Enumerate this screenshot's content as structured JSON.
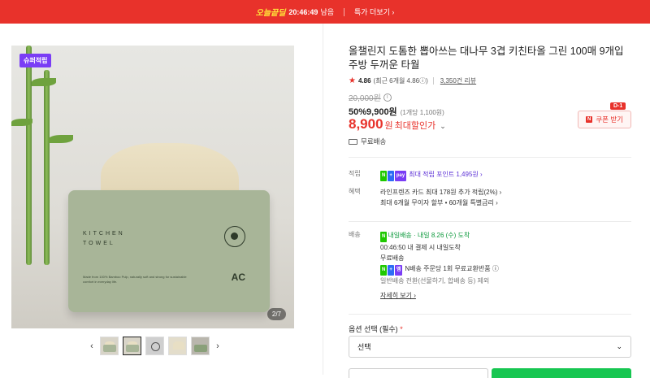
{
  "topbar": {
    "badge": "오늘끝딜",
    "timer": "20:46:49",
    "remain": "남음",
    "deal_link": "특가 더보기 ›"
  },
  "gallery": {
    "super_badge": "슈퍼적립",
    "counter": "2/7",
    "box_text_line1": "KITCHEN",
    "box_text_line2": "TOWEL",
    "box_fine": "Made from 100% Bamboo Pulp, naturally soft and strong for sustainable comfort in everyday life.",
    "box_mark": "AC",
    "prev": "‹",
    "next": "›"
  },
  "product": {
    "title": "올챌린지 도톰한 뽑아쓰는 대나무 3겹 키친타올 그린 100매 9개입 주방 두꺼운 타월",
    "rating": "4.86",
    "rating_recent": "(최근 6개월 4.86ⓘ)",
    "reviews": "3,350건 리뷰",
    "orig_price": "20,000원",
    "discount": "50%",
    "sale_price": "9,900원",
    "unit_price": "(1개당 1,100원)",
    "max_price": "8,900",
    "max_price_unit": "원",
    "max_label": "최대할인가",
    "coupon_label": "쿠폰 받기",
    "coupon_dday": "D-1",
    "shipping": "무료배송"
  },
  "benefits": {
    "point_label": "적립",
    "point_text": "최대 적립 포인트 1,495원 ›",
    "benefit_label": "혜택",
    "benefit_line1": "라인프렌즈 카드 최대 178원 추가 적립(2%) ›",
    "benefit_line2": "최대 6개월 무이자 할부 • 60개월 특별금리 ›"
  },
  "delivery": {
    "label": "배송",
    "arrival": "내일배송 · 내일 8.26 (수) 도착",
    "cutoff": "00:46:50  내 결제 시 내일도착",
    "free": "무료배송",
    "exchange": "N배송 주문당 1회 무료교환반품 ⓘ",
    "except": "일반배송 전환(선물하기, 합배송 등) 제외",
    "detail": "자세히 보기 ›"
  },
  "options": {
    "label": "옵션 선택 (필수)",
    "required_mark": "*",
    "select_value": "선택"
  },
  "colors": {
    "accent": "#e8322b",
    "naver_green": "#1ec800",
    "purple": "#7a3df5"
  }
}
